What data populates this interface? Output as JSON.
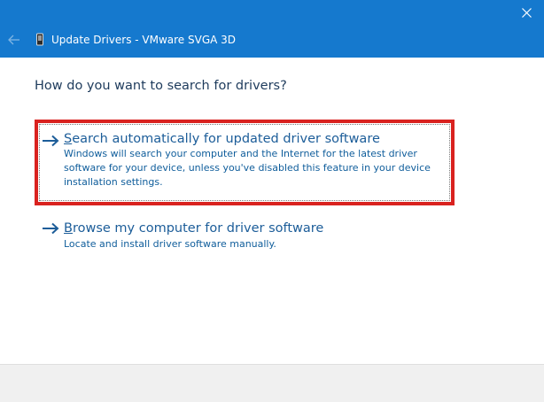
{
  "window": {
    "title": "Update Drivers - VMware SVGA 3D"
  },
  "colors": {
    "titlebar": "#1579ce",
    "link": "#1c5d99",
    "highlight": "#d9221f"
  },
  "icons": {
    "close": "close-icon",
    "back": "back-arrow-icon",
    "device": "device-icon",
    "option_arrow": "arrow-right-icon"
  },
  "main": {
    "heading": "How do you want to search for drivers?",
    "options": [
      {
        "accel": "S",
        "title_rest": "earch automatically for updated driver software",
        "description": "Windows will search your computer and the Internet for the latest driver software for your device, unless you've disabled this feature in your device installation settings.",
        "highlighted": true
      },
      {
        "accel": "B",
        "title_rest": "rowse my computer for driver software",
        "description": "Locate and install driver software manually.",
        "highlighted": false
      }
    ]
  }
}
